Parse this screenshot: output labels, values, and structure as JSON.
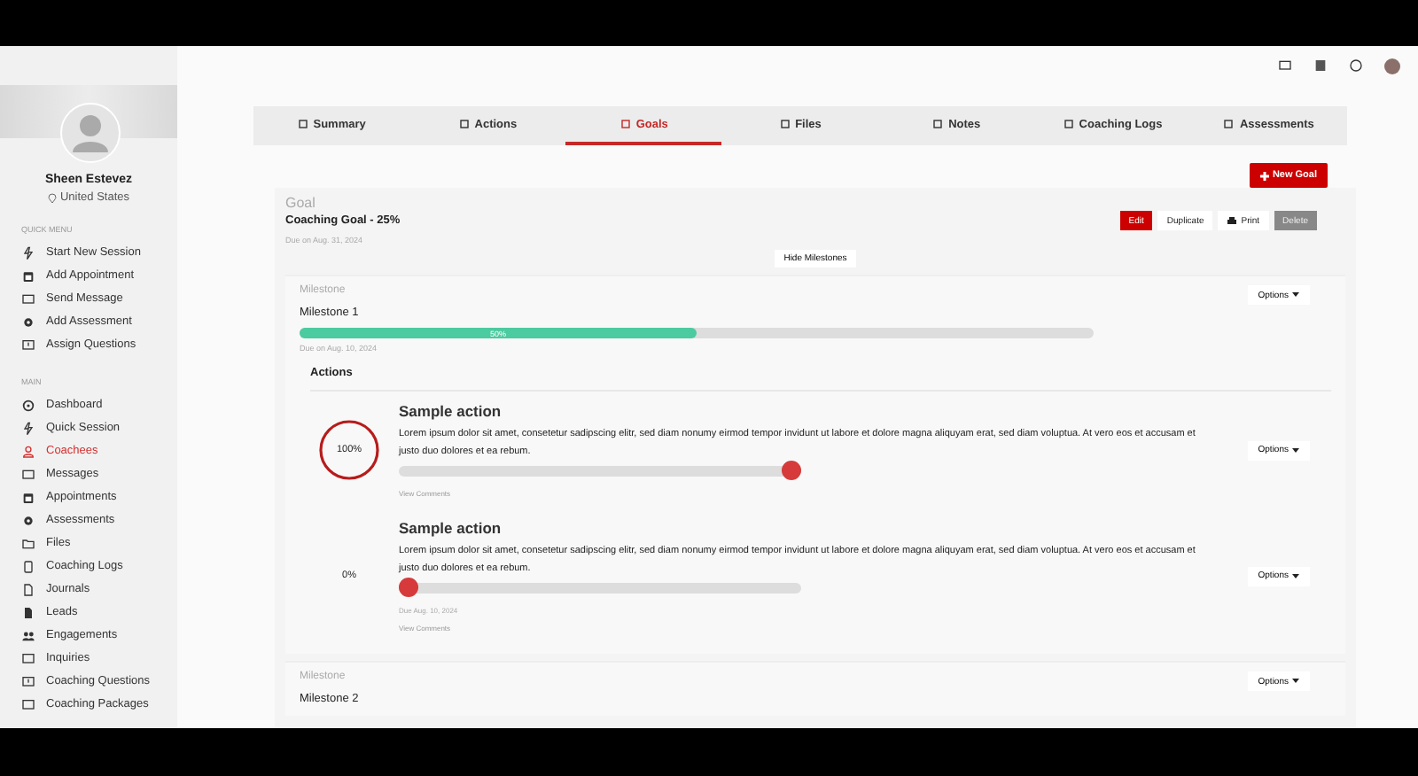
{
  "sidebar": {
    "profile": {
      "name": "Sheen Estevez",
      "location": "United States"
    },
    "quick_menu": {
      "heading": "QUICK MENU",
      "items": [
        {
          "label": "Start New Session",
          "selected": false
        },
        {
          "label": "Add Appointment",
          "selected": false
        },
        {
          "label": "Send Message",
          "selected": false
        },
        {
          "label": "Add Assessment",
          "selected": false
        },
        {
          "label": "Assign Questions",
          "selected": false
        }
      ]
    },
    "main_menu": {
      "heading": "MAIN",
      "items": [
        {
          "label": "Dashboard",
          "selected": false
        },
        {
          "label": "Quick Session",
          "selected": false
        },
        {
          "label": "Coachees",
          "selected": true
        },
        {
          "label": "Messages",
          "selected": false
        },
        {
          "label": "Appointments",
          "selected": false
        },
        {
          "label": "Assessments",
          "selected": false
        },
        {
          "label": "Files",
          "selected": false
        },
        {
          "label": "Coaching Logs",
          "selected": false
        },
        {
          "label": "Journals",
          "selected": false
        },
        {
          "label": "Leads",
          "selected": false
        },
        {
          "label": "Engagements",
          "selected": false
        },
        {
          "label": "Inquiries",
          "selected": false
        },
        {
          "label": "Coaching Questions",
          "selected": false
        },
        {
          "label": "Coaching Packages",
          "selected": false
        }
      ]
    }
  },
  "tabs": [
    {
      "label": "Summary",
      "selected": false
    },
    {
      "label": "Actions",
      "selected": false
    },
    {
      "label": "Goals",
      "selected": true
    },
    {
      "label": "Files",
      "selected": false
    },
    {
      "label": "Notes",
      "selected": false
    },
    {
      "label": "Coaching Logs",
      "selected": false
    },
    {
      "label": "Assessments",
      "selected": false
    }
  ],
  "new_goal_button": "New Goal",
  "goal": {
    "label": "Goal",
    "title": "Coaching Goal - 25%",
    "due": "Due on Aug. 31, 2024",
    "buttons": [
      {
        "label": "Edit",
        "kind": "primary"
      },
      {
        "label": "Duplicate",
        "kind": "plain"
      },
      {
        "label": "Print",
        "kind": "print"
      },
      {
        "label": "Delete",
        "kind": "muted"
      }
    ],
    "toggle": "Hide Milestones"
  },
  "milestones": [
    {
      "label": "Milestone",
      "name": "Milestone 1",
      "options": "Options",
      "level": 0.5,
      "percent": "50%",
      "due": "Due on Aug. 10, 2024",
      "actions_heading": "Actions",
      "actions": [
        {
          "percent": "100%",
          "title": "Sample action",
          "text": "Lorem ipsum dolor sit amet, consetetur sadipscing elitr, sed diam nonumy eirmod tempor invidunt ut labore et dolore magna aliquyam erat, sed diam voluptua. At vero eos et accusam et justo duo dolores et ea rebum.",
          "level": 1,
          "comments": "View Comments",
          "options": "Options"
        },
        {
          "percent": "0%",
          "title": "Sample action",
          "text": "Lorem ipsum dolor sit amet, consetetur sadipscing elitr, sed diam nonumy eirmod tempor invidunt ut labore et dolore magna aliquyam erat, sed diam voluptua. At vero eos et accusam et justo duo dolores et ea rebum.",
          "level": 0,
          "due": "Due Aug. 10, 2024",
          "comments": "View Comments",
          "options": "Options"
        }
      ]
    },
    {
      "label": "Milestone",
      "name": "Milestone 2",
      "options": "Options"
    }
  ]
}
